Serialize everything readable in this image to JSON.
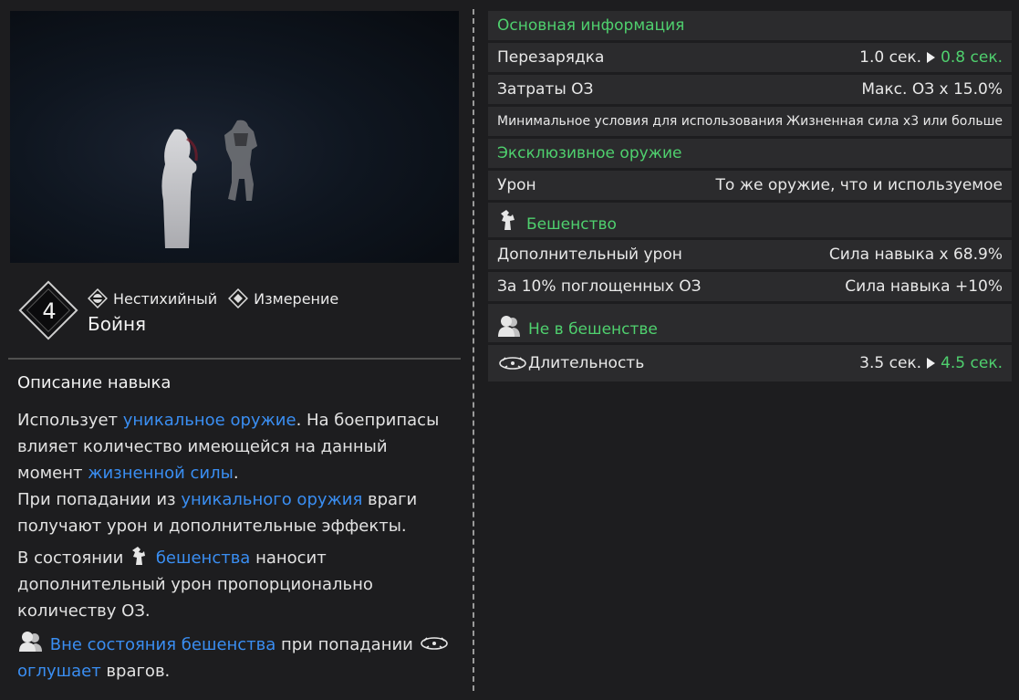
{
  "skill": {
    "level": "4",
    "name": "Бойня",
    "tags": [
      {
        "label": "Нестихийный",
        "icon": "non-elemental-icon"
      },
      {
        "label": "Измерение",
        "icon": "dimension-icon"
      }
    ]
  },
  "description": {
    "title": "Описание навыка",
    "p1_a": "Использует ",
    "p1_link1": "уникальное оружие",
    "p1_b": ". На боеприпасы влияет количество имеющейся на данный момент ",
    "p1_link2": "жизненной силы",
    "p1_c": ".",
    "p2_a": "При попадании из ",
    "p2_link": "уникального оружия",
    "p2_b": " враги получают урон и дополнительные эффекты.",
    "p3_a": "В состоянии ",
    "p3_link": "бешенства",
    "p3_b": " наносит дополнительный урон пропорционально количеству ОЗ.",
    "p4_link": "Вне состояния бешенства",
    "p4_a": " при попадании ",
    "p4_link2": "оглушает",
    "p4_b": " врагов."
  },
  "stats": {
    "basic_title": "Основная информация",
    "cooldown_label": "Перезарядка",
    "cooldown_old": "1.0 сек.",
    "cooldown_new": "0.8 сек.",
    "hp_cost_label": "Затраты ОЗ",
    "hp_cost_value": "Макс. ОЗ x 15.0%",
    "min_cond_label": "Минимальное условия для использования",
    "min_cond_value": "Жизненная сила x3 или больше",
    "exclusive_title": "Эксклюзивное оружие",
    "damage_label": "Урон",
    "damage_value": "То же оружие, что и используемое",
    "berserk_title": "Бешенство",
    "extra_dmg_label": "Дополнительный урон",
    "extra_dmg_value": "Сила навыка x 68.9%",
    "per10_label": "За 10% поглощенных ОЗ",
    "per10_value": "Сила навыка +10%",
    "not_berserk_title": "Не в бешенстве",
    "duration_label": "Длительность",
    "duration_old": "3.5 сек.",
    "duration_new": "4.5 сек."
  },
  "colors": {
    "accent_green": "#4fd06e",
    "link_blue": "#3a8ef2"
  }
}
